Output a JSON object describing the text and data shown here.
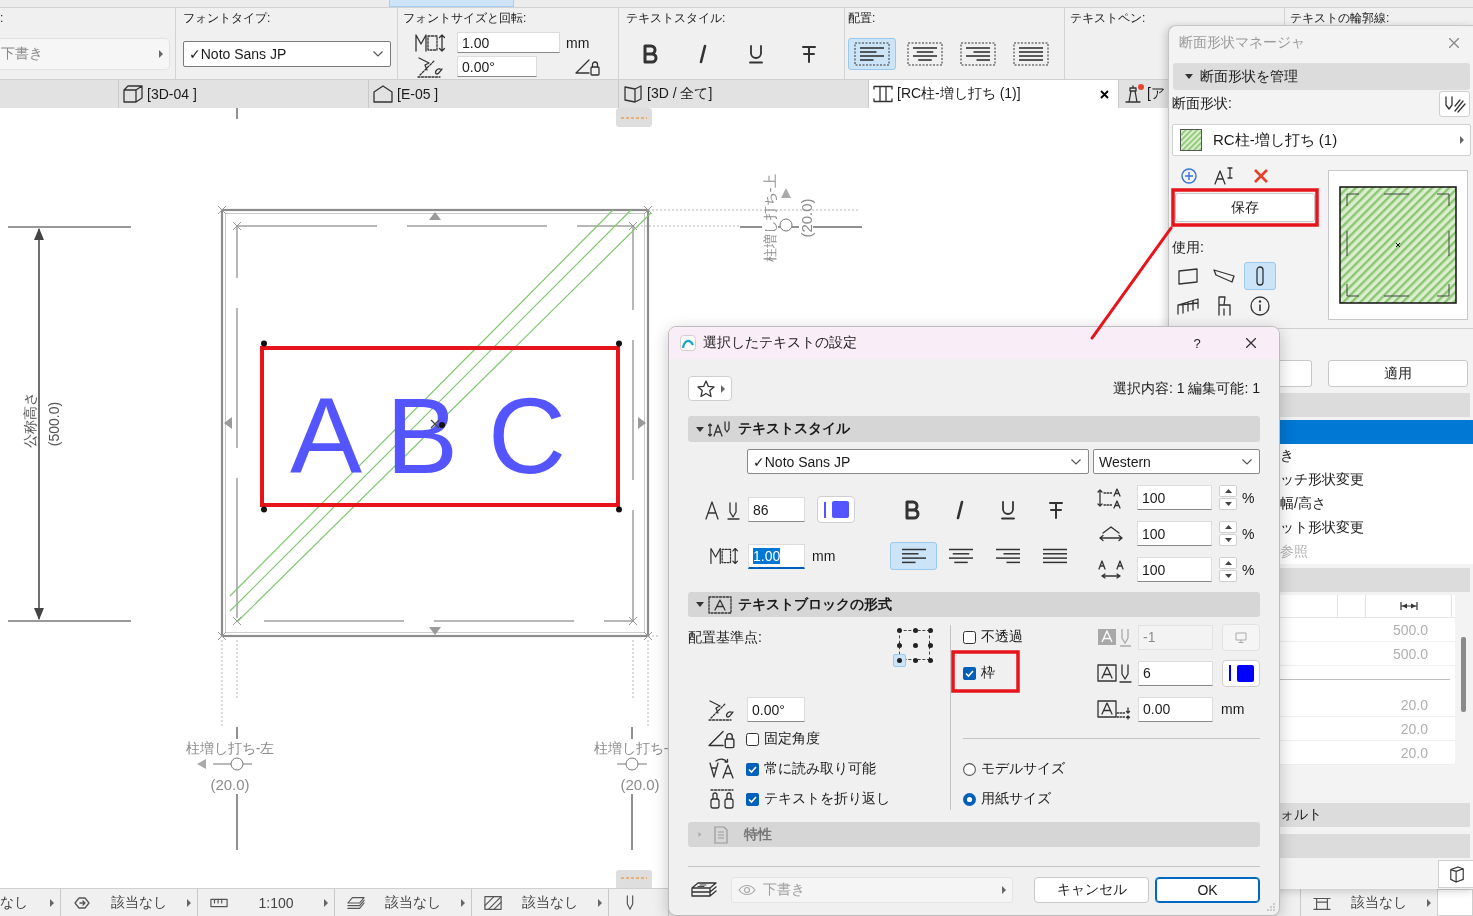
{
  "toolbar": {
    "layer": {
      "label": ":",
      "value": "下書き"
    },
    "font_type": {
      "label": "フォントタイプ:",
      "value": "✓Noto Sans JP"
    },
    "font_size": {
      "label": "フォントサイズと回転:",
      "size": "1.00",
      "unit": "mm",
      "angle": "0.00°"
    },
    "text_style": {
      "label": "テキストスタイル:"
    },
    "alignment": {
      "label": "配置:",
      "options": [
        {
          "kind": "left",
          "selected": true
        },
        {
          "kind": "center",
          "selected": false
        },
        {
          "kind": "right",
          "selected": false
        },
        {
          "kind": "justify",
          "selected": false
        }
      ]
    },
    "text_pen": {
      "label": "テキストペン:"
    },
    "text_outline": {
      "label": "テキストの輪郭線:"
    }
  },
  "tabs": [
    {
      "label": "[3D-04 ]",
      "kind": "model",
      "selected": false,
      "alert": false
    },
    {
      "label": "[E-05 ]",
      "kind": "elevation",
      "selected": false,
      "alert": false
    },
    {
      "label": "[3D / 全て]",
      "kind": "perspective",
      "selected": false,
      "alert": false
    },
    {
      "label": "[RC柱-増し打ち (1)]",
      "kind": "profile",
      "selected": true,
      "alert": false
    },
    {
      "label": "[ア",
      "kind": "layout",
      "selected": false,
      "alert": true
    }
  ],
  "canvas": {
    "text": "A B C",
    "dimension": {
      "label": "公称高さ",
      "value": "(500.0)"
    },
    "offsets": [
      {
        "kind": "top",
        "label": "柱増し打ち-上",
        "value": "(20.0)"
      },
      {
        "kind": "left",
        "label": "柱増し打ち-左",
        "value": "(20.0)"
      },
      {
        "kind": "right",
        "label": "柱増し打ち-",
        "value": "(20.0)"
      }
    ]
  },
  "profile_manager": {
    "title": "断面形状マネージャ",
    "section": {
      "label": "断面形状を管理",
      "expanded": true
    },
    "profile_label": "断面形状:",
    "profile_name": "RC柱-増し打ち (1)",
    "save": "保存",
    "use_label": "使用:",
    "use_options": [
      {
        "kind": "wall",
        "selected": false
      },
      {
        "kind": "beam",
        "selected": false
      },
      {
        "kind": "column",
        "selected": true
      },
      {
        "kind": "railing",
        "selected": false
      },
      {
        "kind": "object",
        "selected": false
      }
    ],
    "apply": "適用",
    "list": [
      {
        "selected": true,
        "disabled": false
      },
      {
        "label": "き",
        "selected": false,
        "disabled": false
      },
      {
        "label": "ッチ形状変更",
        "selected": false,
        "disabled": false
      },
      {
        "label": "幅/高さ",
        "selected": false,
        "disabled": false
      },
      {
        "label": "ット形状変更",
        "selected": false,
        "disabled": false
      },
      {
        "label": "参照",
        "selected": false,
        "disabled": true
      }
    ],
    "table": {
      "groups": [
        {
          "rows": [
            "500.0",
            "500.0"
          ]
        },
        {
          "rows": [
            "20.0",
            "20.0",
            "20.0"
          ]
        }
      ]
    },
    "defaults_header": "ォルト"
  },
  "dialog": {
    "title": "選択したテキストの設定",
    "help": "?",
    "selection_info": "選択内容: 1 編集可能: 1",
    "text_style": {
      "title": "テキストスタイル",
      "expanded": true,
      "font": "✓Noto Sans JP",
      "script": "Western",
      "pen": {
        "value": "86",
        "color": "#5555ff"
      },
      "size": "1.00",
      "size_focused": true,
      "size_unit": "mm",
      "alignment": [
        {
          "kind": "left",
          "selected": true
        },
        {
          "kind": "center",
          "selected": false
        },
        {
          "kind": "right",
          "selected": false
        },
        {
          "kind": "justify",
          "selected": false
        }
      ],
      "scales": [
        {
          "kind": "leading",
          "value": "100",
          "unit": "%"
        },
        {
          "kind": "width",
          "value": "100",
          "unit": "%"
        },
        {
          "kind": "tracking",
          "value": "100",
          "unit": "%"
        }
      ]
    },
    "text_block": {
      "title": "テキストブロックの形式",
      "expanded": true,
      "anchor_label": "配置基準点:",
      "anchor_points": [
        {
          "selected": false
        },
        {
          "selected": false
        },
        {
          "selected": false
        },
        {
          "selected": false
        },
        {
          "selected": false
        },
        {
          "selected": false
        },
        {
          "selected": true
        },
        {
          "selected": false
        },
        {
          "selected": false
        }
      ],
      "angle": "0.00°",
      "options": [
        {
          "kind": "lock",
          "label": "固定角度",
          "checked": false
        },
        {
          "kind": "readable",
          "label": "常に読み取り可能",
          "checked": true
        },
        {
          "kind": "wrap",
          "label": "テキストを折り返し",
          "checked": true
        }
      ],
      "opaque": {
        "label": "不透過",
        "checked": false
      },
      "frame": {
        "label": "枠",
        "checked": true
      },
      "background_pen": {
        "value": "-1",
        "disabled": true
      },
      "frame_pen": {
        "value": "6",
        "color": "#0000ff"
      },
      "frame_offset": {
        "value": "0.00",
        "unit": "mm"
      },
      "size_modes": [
        {
          "label": "モデルサイズ",
          "selected": false
        },
        {
          "label": "用紙サイズ",
          "selected": true
        }
      ]
    },
    "properties": {
      "title": "特性",
      "expanded": false,
      "disabled": true
    },
    "layer": {
      "value": "下書き",
      "disabled": true
    },
    "buttons": [
      {
        "kind": "cancel",
        "label": "キャンセル"
      },
      {
        "kind": "ok",
        "label": "OK"
      }
    ]
  },
  "status_bar": {
    "left": [
      {
        "kind": "plain",
        "value": "なし"
      },
      {
        "kind": "renovation",
        "value": "該当なし"
      },
      {
        "kind": "scale",
        "value": "1:100"
      },
      {
        "kind": "layers",
        "value": "該当なし"
      },
      {
        "kind": "hatch",
        "value": "該当なし"
      },
      {
        "kind": "pen"
      }
    ],
    "right": [
      {
        "kind": "door",
        "value": "該当なし"
      }
    ]
  }
}
